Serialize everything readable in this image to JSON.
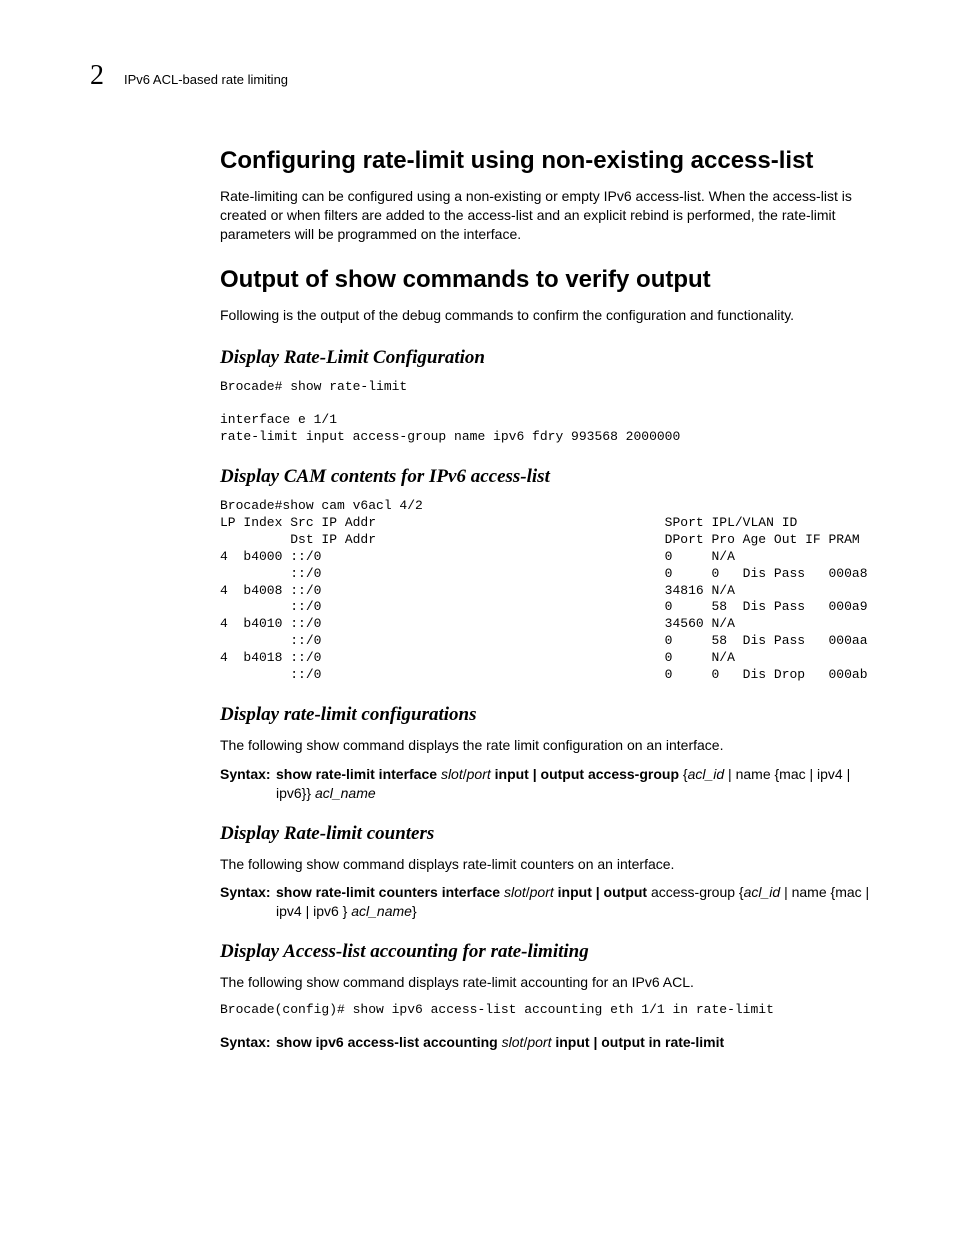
{
  "header": {
    "chapter": "2",
    "title": "IPv6 ACL-based rate limiting"
  },
  "sec1": {
    "title": "Configuring rate-limit using non-existing access-list",
    "para": "Rate-limiting can be configured using a non-existing or empty IPv6 access-list. When the access-list is created or when filters are added to the access-list and an explicit rebind is performed, the rate-limit parameters will be programmed on the interface."
  },
  "sec2": {
    "title": "Output of show commands to verify output",
    "para": "Following is the output of the debug commands to confirm the configuration and functionality."
  },
  "sub1": {
    "title": "Display Rate-Limit Configuration",
    "code": "Brocade# show rate-limit\n\ninterface e 1/1\nrate-limit input access-group name ipv6 fdry 993568 2000000"
  },
  "sub2": {
    "title": "Display CAM contents for IPv6 access-list",
    "code": "Brocade#show cam v6acl 4/2\nLP Index Src IP Addr                                     SPort IPL/VLAN ID\n         Dst IP Addr                                     DPort Pro Age Out IF PRAM\n4  b4000 ::/0                                            0     N/A\n         ::/0                                            0     0   Dis Pass   000a8\n4  b4008 ::/0                                            34816 N/A\n         ::/0                                            0     58  Dis Pass   000a9\n4  b4010 ::/0                                            34560 N/A\n         ::/0                                            0     58  Dis Pass   000aa\n4  b4018 ::/0                                            0     N/A\n         ::/0                                            0     0   Dis Drop   000ab"
  },
  "sub3": {
    "title": "Display rate-limit configurations",
    "para": "The following show command displays the rate limit configuration on an interface.",
    "syntax_label": "Syntax:",
    "syn": {
      "p1": "show rate-limit interface ",
      "p2": "slot",
      "p3": "/",
      "p4": "port",
      "p5": "  input | output   access-group ",
      "p6": "{",
      "p7": "acl_id",
      "p8": " | name {mac | ipv4 | ipv6}} ",
      "p9": "acl_name"
    }
  },
  "sub4": {
    "title": "Display Rate-limit counters",
    "para": "The following show command displays rate-limit counters on an interface.",
    "syntax_label": "Syntax:",
    "syn": {
      "p1": "show rate-limit counters interface  ",
      "p2": "slot",
      "p3": "/",
      "p4": "port",
      "p5": "  input | output ",
      "p6": "access-group {",
      "p7": "acl_id",
      "p8": " | name {mac | ipv4 | ipv6 } ",
      "p9": "acl_name",
      "p10": "}"
    }
  },
  "sub5": {
    "title": "Display Access-list accounting for rate-limiting",
    "para": "The following show command displays rate-limit accounting for an IPv6 ACL.",
    "code": "Brocade(config)# show ipv6 access-list accounting eth 1/1 in rate-limit",
    "syntax_label": "Syntax:",
    "syn": {
      "p1": "show ipv6 access-list accounting ",
      "p2": "slot",
      "p3": "/",
      "p4": "port",
      "p5": " input | output  in rate-limit"
    }
  }
}
